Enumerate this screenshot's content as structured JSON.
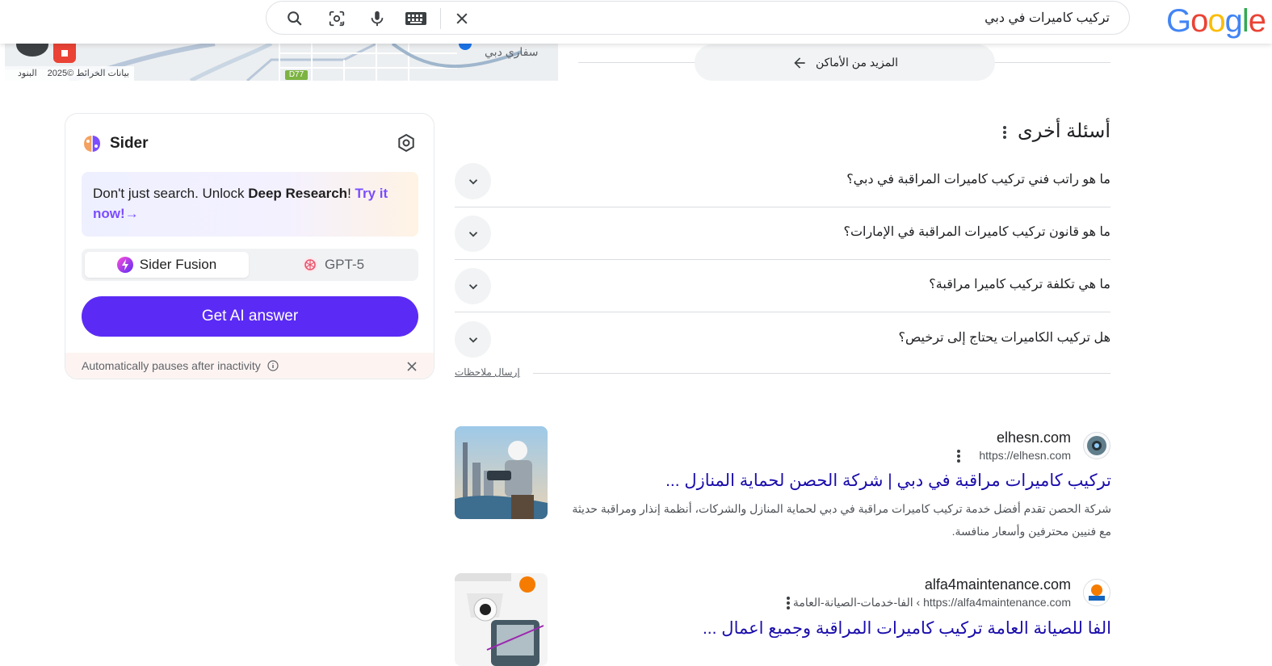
{
  "header": {
    "logo": "Google",
    "search_query": "تركيب كاميرات في دبي",
    "logo_colors": [
      "#4285F4",
      "#EA4335",
      "#FBBC05",
      "#4285F4",
      "#34A853",
      "#EA4335"
    ]
  },
  "map": {
    "attribution": "بيانات الخرائط ©2025",
    "terms": "البنود",
    "road_label": "D77",
    "place_label": "سفاري دبي"
  },
  "more_places": {
    "label": "المزيد من الأماكن"
  },
  "sider": {
    "title": "Sider",
    "promo_lead": "Don't just search. Unlock ",
    "promo_bold": "Deep Research",
    "promo_excl": "! ",
    "promo_link": "Try it now!→",
    "model_a": "Sider Fusion",
    "model_b": "GPT-5",
    "get_answer": "Get AI answer",
    "pause_note": "Automatically pauses after inactivity",
    "accent": "#5b2bf5"
  },
  "paa": {
    "title": "أسئلة أخرى",
    "questions": [
      "ما هو راتب فني تركيب كاميرات المراقبة في دبي؟",
      "ما هو قانون تركيب كاميرات المراقبة في الإمارات؟",
      "ما هي تكلفة تركيب كاميرا مراقبة؟",
      "هل تركيب الكاميرات يحتاج إلى ترخيص؟"
    ],
    "feedback": "إرسال ملاحظات"
  },
  "results": [
    {
      "site": "elhesn.com",
      "url": "https://elhesn.com",
      "title": "تركيب كاميرات مراقبة في دبي | شركة الحصن لحماية المنازل ...",
      "snippet_line1": "شركة الحصن تقدم أفضل خدمة تركيب كاميرات مراقبة في دبي لحماية المنازل والشركات، أنظمة إنذار ومراقبة حديثة",
      "snippet_line2": "مع فنيين محترفين وأسعار منافسة."
    },
    {
      "site": "alfa4maintenance.com",
      "url": "https://alfa4maintenance.com › الفا-خدمات-الصيانة-العامة",
      "title": "الفا للصيانة العامة تركيب كاميرات المراقبة وجميع اعمال ..."
    }
  ]
}
